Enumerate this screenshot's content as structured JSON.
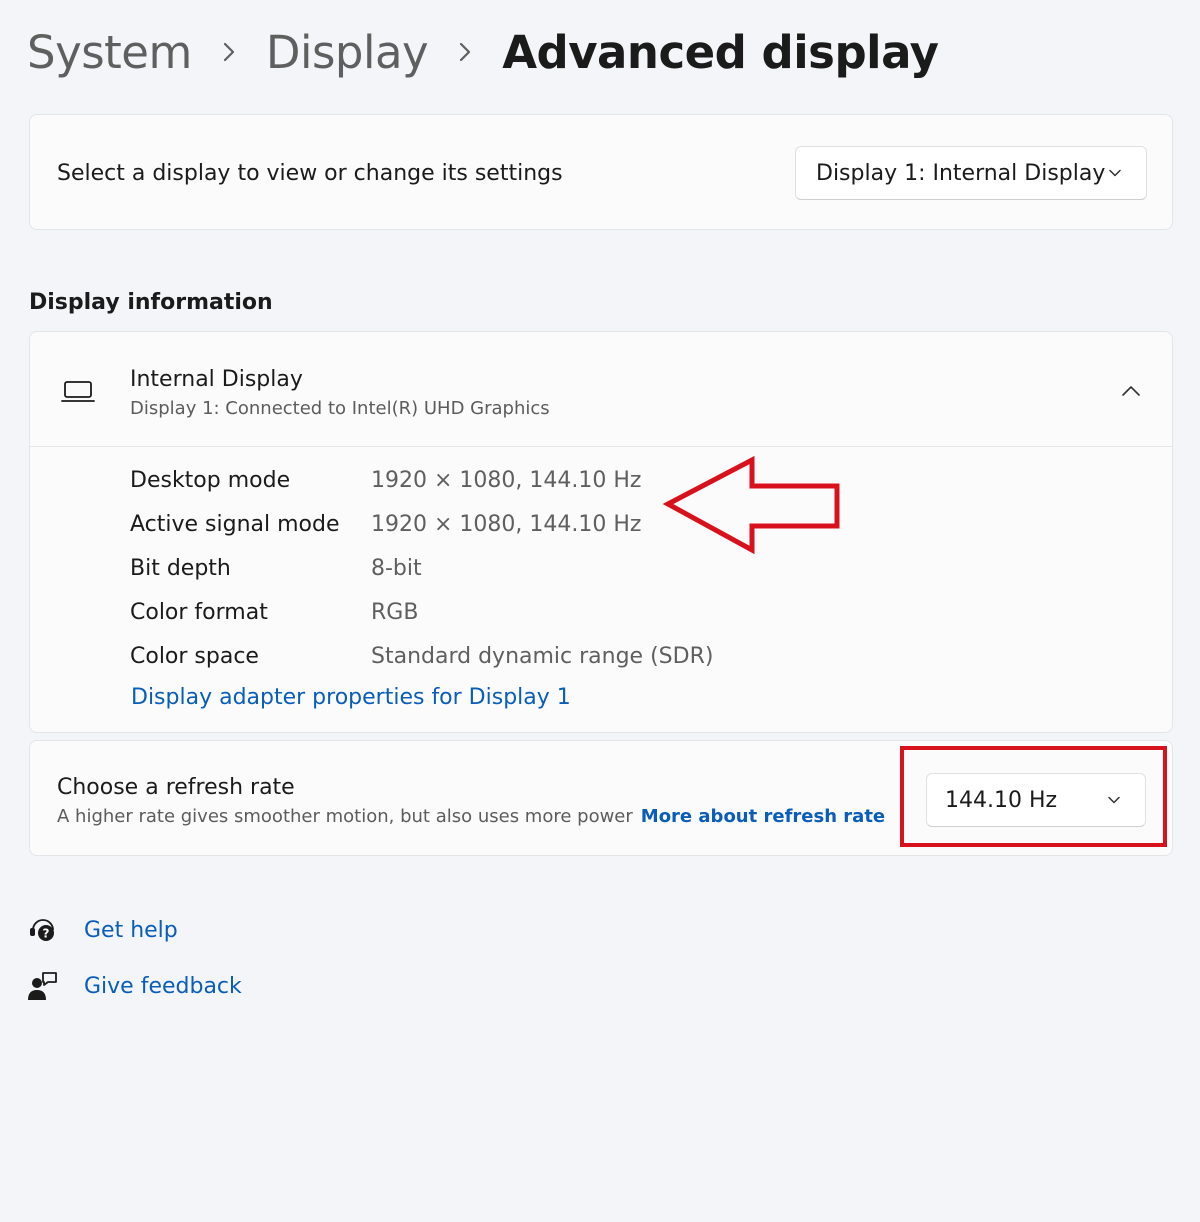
{
  "breadcrumb": {
    "items": [
      "System",
      "Display",
      "Advanced display"
    ]
  },
  "display_select": {
    "label": "Select a display to view or change its settings",
    "selected": "Display 1: Internal Display"
  },
  "display_information": {
    "section_title": "Display information",
    "display_name": "Internal Display",
    "display_subtitle": "Display 1: Connected to Intel(R) UHD Graphics",
    "rows": [
      {
        "label": "Desktop mode",
        "value": "1920 × 1080, 144.10 Hz"
      },
      {
        "label": "Active signal mode",
        "value": "1920 × 1080, 144.10 Hz"
      },
      {
        "label": "Bit depth",
        "value": "8-bit"
      },
      {
        "label": "Color format",
        "value": "RGB"
      },
      {
        "label": "Color space",
        "value": "Standard dynamic range (SDR)"
      }
    ],
    "adapter_link": "Display adapter properties for Display 1"
  },
  "refresh_rate": {
    "title": "Choose a refresh rate",
    "description": "A higher rate gives smoother motion, but also uses more power",
    "link": "More about refresh rate",
    "selected": "144.10 Hz"
  },
  "help_links": {
    "get_help": "Get help",
    "give_feedback": "Give feedback"
  },
  "colors": {
    "accent_link": "#0a5db8",
    "annotation_red": "#d8121d",
    "background": "#f3f5f9",
    "card": "#fbfbfc"
  },
  "icons": {
    "display": "laptop-icon",
    "collapse": "chevron-up-icon",
    "dropdown": "chevron-down-icon",
    "help": "help-icon",
    "feedback": "feedback-icon"
  }
}
